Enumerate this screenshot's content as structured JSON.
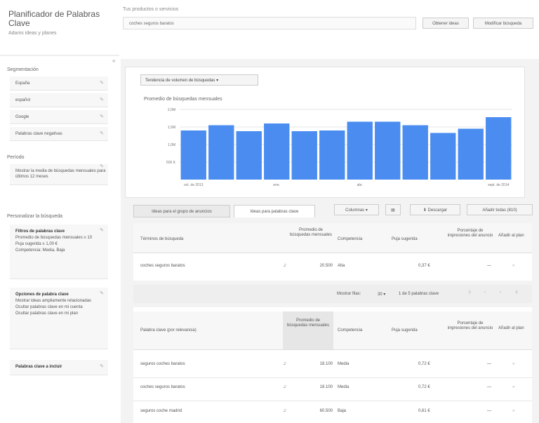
{
  "header": {
    "title": "Planificador de Palabras Clave",
    "subtitle": "Adams ideas y planes",
    "keyword_label": "Tus productos o servicios",
    "keyword_value": "coches seguros baratos",
    "btn_get_ideas": "Obtener ideas",
    "btn_modify": "Modificar búsqueda"
  },
  "sidebar": {
    "targeting_label": "Segmentación",
    "targeting_items": [
      "España",
      "español",
      "Google",
      "Palabras clave negativas"
    ],
    "dates_label": "Período",
    "dates_text": "Mostrar la media de búsquedas mensuales para últimos 12 meses",
    "customize_label": "Personalizar la búsqueda",
    "filters_title": "Filtros de palabras clave",
    "filters_lines": [
      "Promedio de búsquedas mensuales ≥ 10",
      "Puja sugerida ≥ 1,00 €",
      "Competencia: Media, Baja"
    ],
    "options_title": "Opciones de palabra clave",
    "options_lines": [
      "Mostrar ideas ampliamente relacionadas",
      "Ocultar palabras clave en mi cuenta",
      "Ocultar palabras clave en mi plan"
    ],
    "include_label": "Palabras clave a incluir"
  },
  "chart": {
    "select_label": "Tendencia de volumen de búsquedas",
    "title": "Promedio de búsquedas mensuales",
    "y_ticks": [
      "2,0M",
      "1,5M",
      "1,0M",
      "500 K"
    ],
    "x_ticks": [
      "oct. de 2013",
      "ene.",
      "abr.",
      "sept. de 2014"
    ]
  },
  "chart_data": {
    "type": "bar",
    "title": "Promedio de búsquedas mensuales",
    "ylim": [
      0,
      2000000
    ],
    "categories": [
      "oct. de 2013",
      "",
      "",
      "ene.",
      "",
      "",
      "abr.",
      "",
      "",
      "",
      "",
      "sept. de 2014"
    ],
    "values": [
      1400000,
      1550000,
      1380000,
      1600000,
      1380000,
      1400000,
      1650000,
      1650000,
      1550000,
      1330000,
      1450000,
      1780000
    ]
  },
  "tabs": {
    "ad_groups": "Ideas para el grupo de anuncios",
    "keywords": "Ideas para palabras clave",
    "columns": "Columnas",
    "download": "Descargar",
    "add_all": "Añadir todas (810)"
  },
  "table1": {
    "headers": [
      "Términos de búsqueda",
      "Promedio de búsquedas mensuales",
      "Competencia",
      "Puja sugerida",
      "Porcentaje de impresiones del anuncio",
      "Añadir al plan"
    ],
    "rows": [
      [
        "coches seguros baratos",
        "20.500",
        "Alta",
        "0,37 €",
        "—"
      ]
    ]
  },
  "pagination": {
    "rows_label": "Mostrar filas:",
    "rows_value": "30",
    "range": "1 de 5 palabras clave"
  },
  "table2": {
    "headers": [
      "Palabra clave (por relevancia)",
      "Promedio de búsquedas mensuales",
      "Competencia",
      "Puja sugerida",
      "Porcentaje de impresiones del anuncio",
      "Añadir al plan"
    ],
    "rows": [
      [
        "seguros coches baratos",
        "18.100",
        "Media",
        "0,72 €",
        "—"
      ],
      [
        "coches seguros baratos",
        "18.100",
        "Media",
        "0,72 €",
        "—"
      ],
      [
        "seguros coche madrid",
        "60.500",
        "Baja",
        "0,61 €",
        "—"
      ]
    ]
  }
}
